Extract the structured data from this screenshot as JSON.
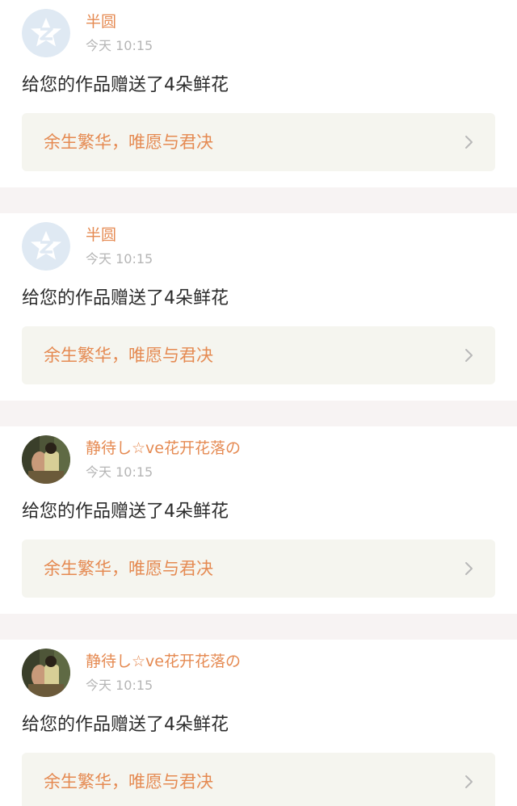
{
  "notifications": [
    {
      "avatar": "qzone-default-avatar",
      "username": "半圆",
      "time": "今天 10:15",
      "message": "给您的作品赠送了4朵鲜花",
      "work_title": "余生繁华，唯愿与君决"
    },
    {
      "avatar": "qzone-default-avatar",
      "username": "半圆",
      "time": "今天 10:15",
      "message": "给您的作品赠送了4朵鲜花",
      "work_title": "余生繁华，唯愿与君决"
    },
    {
      "avatar": "photo-avatar",
      "username": "静待し☆ve花开花落の",
      "time": "今天 10:15",
      "message": "给您的作品赠送了4朵鲜花",
      "work_title": "余生繁华，唯愿与君决"
    },
    {
      "avatar": "photo-avatar",
      "username": "静待し☆ve花开花落の",
      "time": "今天 10:15",
      "message": "给您的作品赠送了4朵鲜花",
      "work_title": "余生繁华，唯愿与君决"
    }
  ],
  "colors": {
    "username": "#e58a52",
    "link_text": "#e58a52",
    "link_bg": "#f5f5ef",
    "time": "#b5b5b5",
    "message": "#2b2b2b",
    "separator": "#f7f3f3"
  }
}
